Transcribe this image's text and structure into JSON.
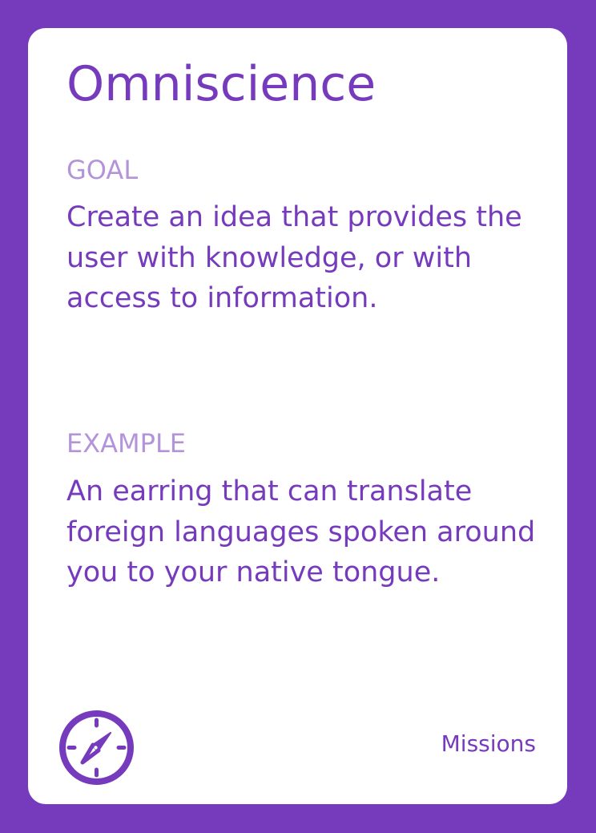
{
  "card": {
    "title": "Omniscience",
    "goal_label": "GOAL",
    "goal_text": "Create an idea that provides the user with knowledge, or with access to information.",
    "example_label": "EXAMPLE",
    "example_text": "An earring that can translate foreign languages spoken around you to your native tongue.",
    "deck_name": "Missions",
    "icon": "compass-icon"
  },
  "colors": {
    "background": "#763bbd",
    "card": "#ffffff",
    "primary_text": "#763bbd",
    "label_text": "#b394da"
  }
}
